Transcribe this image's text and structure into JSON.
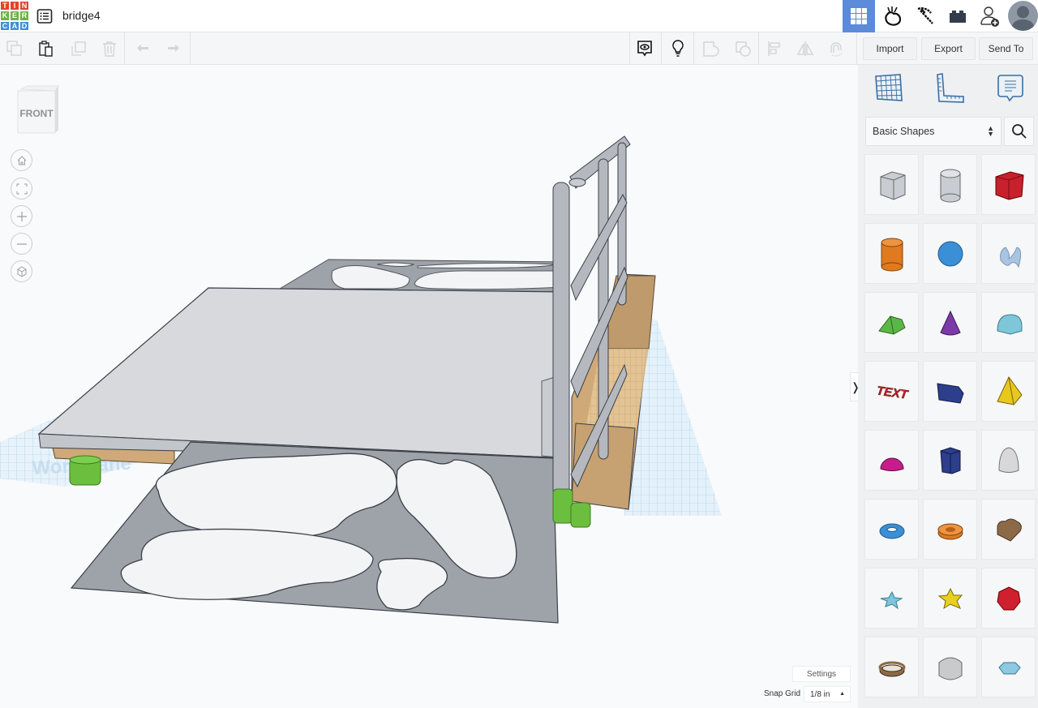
{
  "app": {
    "logo_letters": [
      "T",
      "I",
      "N",
      "K",
      "E",
      "R",
      "C",
      "A",
      "D"
    ],
    "logo_colors": [
      "#e2432a",
      "#e2432a",
      "#e2432a",
      "#6ab543",
      "#6ab543",
      "#6ab543",
      "#3e8fd0",
      "#3e8fd0",
      "#3e8fd0"
    ],
    "design_title": "bridge4"
  },
  "top_nav": {
    "items": [
      {
        "name": "3d-design-view",
        "icon": "grid-icon",
        "active": true
      },
      {
        "name": "codeblocks-view",
        "icon": "tinker-hand-icon",
        "active": false
      },
      {
        "name": "minecraft-view",
        "icon": "pickaxe-icon",
        "active": false
      },
      {
        "name": "lego-view",
        "icon": "brick-icon",
        "active": false
      },
      {
        "name": "invite-user",
        "icon": "add-user-icon",
        "active": false
      }
    ],
    "accent": "#5b8bd9"
  },
  "toolbar": {
    "left": [
      {
        "name": "copy",
        "icon": "copy-icon",
        "enabled": false
      },
      {
        "name": "paste",
        "icon": "paste-icon",
        "enabled": true
      },
      {
        "name": "duplicate",
        "icon": "duplicate-icon",
        "enabled": false
      },
      {
        "name": "delete",
        "icon": "trash-icon",
        "enabled": false
      },
      {
        "name": "undo",
        "icon": "undo-icon",
        "enabled": false
      },
      {
        "name": "redo",
        "icon": "redo-icon",
        "enabled": false
      }
    ],
    "right": [
      {
        "name": "show-all",
        "icon": "eye-bubble-icon",
        "enabled": true
      },
      {
        "name": "notes",
        "icon": "lightbulb-icon",
        "enabled": true
      },
      {
        "name": "group",
        "icon": "group-icon",
        "enabled": false
      },
      {
        "name": "ungroup",
        "icon": "ungroup-icon",
        "enabled": false
      },
      {
        "name": "align",
        "icon": "align-icon",
        "enabled": false
      },
      {
        "name": "mirror",
        "icon": "mirror-icon",
        "enabled": false
      },
      {
        "name": "cruise",
        "icon": "magnet-icon",
        "enabled": false
      }
    ],
    "import_label": "Import",
    "export_label": "Export",
    "send_to_label": "Send To"
  },
  "panel": {
    "tools": [
      {
        "name": "workplane",
        "icon": "workplane-grid-icon"
      },
      {
        "name": "ruler",
        "icon": "ruler-icon"
      },
      {
        "name": "notes",
        "icon": "note-icon"
      }
    ],
    "category": "Basic Shapes",
    "shapes": [
      {
        "name": "Box Hole",
        "color": "#b9bec6"
      },
      {
        "name": "Cylinder Hole",
        "color": "#b9bec6"
      },
      {
        "name": "Box",
        "color": "#c8202c"
      },
      {
        "name": "Cylinder",
        "color": "#e07a1e"
      },
      {
        "name": "Sphere",
        "color": "#3a8fd6"
      },
      {
        "name": "Scribble",
        "color": "#a8c4e0"
      },
      {
        "name": "Roof",
        "color": "#5bb648"
      },
      {
        "name": "Cone",
        "color": "#7c3aa8"
      },
      {
        "name": "Round Roof",
        "color": "#7ec6d8"
      },
      {
        "name": "Text",
        "color": "#c4242c"
      },
      {
        "name": "Wedge",
        "color": "#2c3e8c"
      },
      {
        "name": "Pyramid",
        "color": "#e8c81c"
      },
      {
        "name": "Half Sphere",
        "color": "#c81c8c"
      },
      {
        "name": "Polygon",
        "color": "#2c3e8c"
      },
      {
        "name": "Paraboloid",
        "color": "#d8d8da"
      },
      {
        "name": "Torus",
        "color": "#3a8fd6"
      },
      {
        "name": "Tube",
        "color": "#e07a1e"
      },
      {
        "name": "Heart",
        "color": "#8c6a48"
      },
      {
        "name": "Star",
        "color": "#7ec6e0"
      },
      {
        "name": "Star Yellow",
        "color": "#e8d01c"
      },
      {
        "name": "Icosahedron",
        "color": "#d02030"
      },
      {
        "name": "Ring",
        "color": "#8c6a48"
      },
      {
        "name": "Rounded Cube",
        "color": "#c8cacc"
      },
      {
        "name": "Gem",
        "color": "#8cc8e0"
      }
    ]
  },
  "viewport": {
    "view_cube_label": "FRONT",
    "nav_buttons": [
      {
        "name": "home-view",
        "icon": "home-icon"
      },
      {
        "name": "fit-view",
        "icon": "fit-icon"
      },
      {
        "name": "zoom-in",
        "icon": "plus-icon"
      },
      {
        "name": "zoom-out",
        "icon": "minus-icon"
      },
      {
        "name": "perspective",
        "icon": "cube-icon"
      }
    ],
    "workplane_label": "Workplane",
    "settings_label": "Settings",
    "snap_grid_label": "Snap Grid",
    "snap_grid_value": "1/8 in",
    "collapse_glyph": "❭"
  }
}
